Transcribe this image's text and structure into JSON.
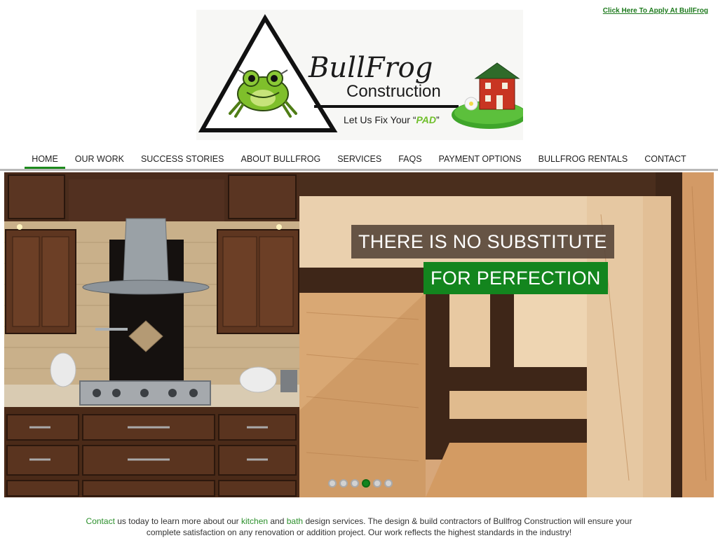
{
  "header": {
    "apply_link": "Click Here To Apply At BullFrog"
  },
  "logo": {
    "name_line1": "BullFrog",
    "name_line2": "Construction",
    "tagline_prefix": "Let Us Fix Your “",
    "tagline_word": "PAD",
    "tagline_suffix": "”"
  },
  "nav": {
    "items": [
      {
        "label": "HOME"
      },
      {
        "label": "OUR WORK"
      },
      {
        "label": "SUCCESS STORIES"
      },
      {
        "label": "ABOUT BULLFROG"
      },
      {
        "label": "SERVICES"
      },
      {
        "label": "FAQS"
      },
      {
        "label": "PAYMENT OPTIONS"
      },
      {
        "label": "BULLFROG RENTALS"
      },
      {
        "label": "CONTACT"
      }
    ],
    "active_index": 0
  },
  "slider": {
    "caption_line1": "THERE IS NO SUBSTITUTE",
    "caption_line2": "FOR PERFECTION",
    "slide_count": 6,
    "active_slide": 4
  },
  "intro": {
    "link_contact": "Contact",
    "text1": " us today to learn more about our ",
    "link_kitchen": "kitchen",
    "text2": " and ",
    "link_bath": "bath",
    "text3": " design services. The design & build contractors of Bullfrog Construction will ensure your complete satisfaction on any renovation or addition project. Our work reflects the highest standards in the industry!"
  },
  "colors": {
    "accent_green": "#13851e",
    "link_green": "#2b8f2b",
    "caption_brown": "#58463a"
  }
}
